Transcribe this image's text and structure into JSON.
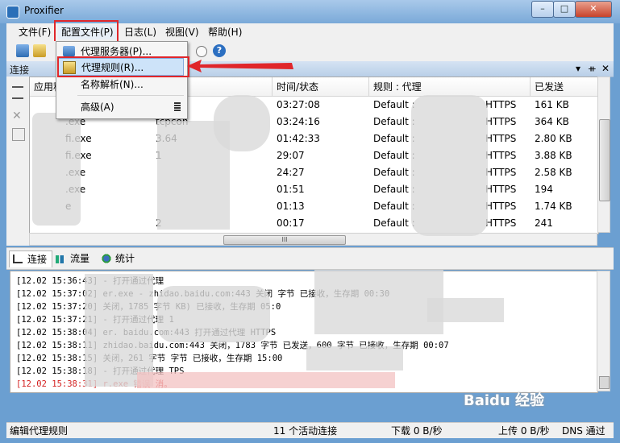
{
  "window": {
    "title": "Proxifier",
    "min": "–",
    "max": "□",
    "close": "✕"
  },
  "menu": [
    "文件(F)",
    "配置文件(P)",
    "日志(L)",
    "视图(V)",
    "帮助(H)"
  ],
  "dropdown": {
    "items": [
      {
        "label": "代理服务器(P)..."
      },
      {
        "label": "代理规则(R)..."
      },
      {
        "label": "名称解析(N)..."
      },
      {
        "label": "高级(A)"
      }
    ]
  },
  "pane": {
    "title": "连接",
    "controls": [
      "▾",
      "ᚑ",
      "✕"
    ]
  },
  "table": {
    "columns": [
      "应用程",
      "",
      "时间/状态",
      "规则 : 代理",
      "已发送"
    ],
    "rows": [
      {
        "app": "",
        "target": "7.13",
        "time": "03:27:08",
        "rule": "Default :",
        "proxy": "HTTPS",
        "sent": "161 KB"
      },
      {
        "app": ".exe",
        "target": "tcpcon",
        "time": "03:24:16",
        "rule": "Default :",
        "proxy": "HTTPS",
        "sent": "364 KB"
      },
      {
        "app": "fi.exe",
        "target": "3.64",
        "time": "01:42:33",
        "rule": "Default :",
        "proxy": "HTTPS",
        "sent": "2.80 KB"
      },
      {
        "app": "fi.exe",
        "target": "1",
        "time": "29:07",
        "rule": "Default :",
        "proxy": "HTTPS",
        "sent": "3.88 KB"
      },
      {
        "app": ".exe",
        "target": "",
        "time": "24:27",
        "rule": "Default :",
        "proxy": "HTTPS",
        "sent": "2.58 KB"
      },
      {
        "app": ".exe",
        "target": "",
        "time": "01:51",
        "rule": "Default :",
        "proxy": "HTTPS",
        "sent": "194"
      },
      {
        "app": "e",
        "target": "",
        "time": "01:13",
        "rule": "Default :",
        "proxy": "HTTPS",
        "sent": "1.74 KB"
      },
      {
        "app": "",
        "target": "2",
        "time": "00:17",
        "rule": "Default :",
        "proxy": "HTTPS",
        "sent": "241"
      }
    ],
    "scroll_grip": "III"
  },
  "tabs": [
    {
      "label": "连接"
    },
    {
      "label": "流量"
    },
    {
      "label": "统计"
    }
  ],
  "log": {
    "lines": [
      {
        "time": "[12.02 15:36:43]",
        "text": "-                    打开通过代理",
        "error": false
      },
      {
        "time": "[12.02 15:37:02]",
        "text": "er.exe - zhidao.baidu.com:443 关闭                                    字节 已接收，生存期 00:30",
        "error": false
      },
      {
        "time": "[12.02 15:37:20]",
        "text": "关闭，1785 字节                     KB) 已接收，生存期 05:0",
        "error": false
      },
      {
        "time": "[12.02 15:37:21]",
        "text": "-                    打开通过代理 1",
        "error": false
      },
      {
        "time": "[12.02 15:38:04]",
        "text": "er.        baidu.com:443 打开通过代理                        HTTPS",
        "error": false
      },
      {
        "time": "[12.02 15:38:11]",
        "text": "       zhidao.baidu.com:443 关闭，1783 字节                    已发送，600 字节 已接收，生存期 00:07",
        "error": false
      },
      {
        "time": "[12.02 15:38:15]",
        "text": "关闭，261 字节                     字节 已接收，生存期 15:00",
        "error": false
      },
      {
        "time": "[12.02 15:38:18]",
        "text": "-                    打开通过代理                                  TPS",
        "error": false
      },
      {
        "time": "[12.02 15:38:31]",
        "text": "r.exe              错误                                           消。",
        "error": true
      }
    ]
  },
  "status": {
    "left": "编辑代理规则",
    "connections": "11 个活动连接",
    "download": "下载 0 B/秒",
    "upload": "上传 0 B/秒",
    "dns": "DNS 通过"
  },
  "watermark": "Baidu 经验",
  "colors": {
    "titlebar": "#7aa9d8",
    "highlight": "#e0262b",
    "selection": "#cde3f9",
    "error_text": "#d42020"
  }
}
